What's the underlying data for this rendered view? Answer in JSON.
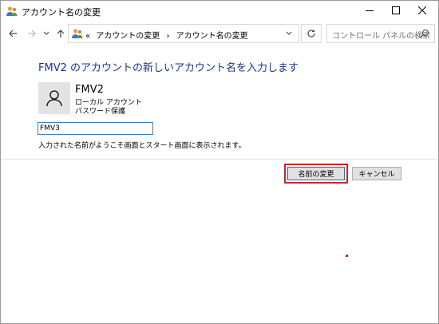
{
  "window": {
    "title": "アカウント名の変更"
  },
  "nav": {
    "breadcrumb_prefix": "«",
    "breadcrumb": [
      "アカウントの変更",
      "アカウント名の変更"
    ],
    "breadcrumb_separator": "›",
    "search_placeholder": "コントロール パネルの検索"
  },
  "main": {
    "heading": "FMV2 のアカウントの新しいアカウント名を入力します",
    "account": {
      "name": "FMV2",
      "type": "ローカル アカウント",
      "password_status": "パスワード保護"
    },
    "new_name_value": "FMV3",
    "hint": "入力された名前がようこそ画面とスタート画面に表示されます。"
  },
  "buttons": {
    "change_name": "名前の変更",
    "cancel": "キャンセル"
  },
  "colors": {
    "heading": "#1e3287",
    "highlight": "#d61f2a",
    "input_border": "#3c7fb1"
  }
}
